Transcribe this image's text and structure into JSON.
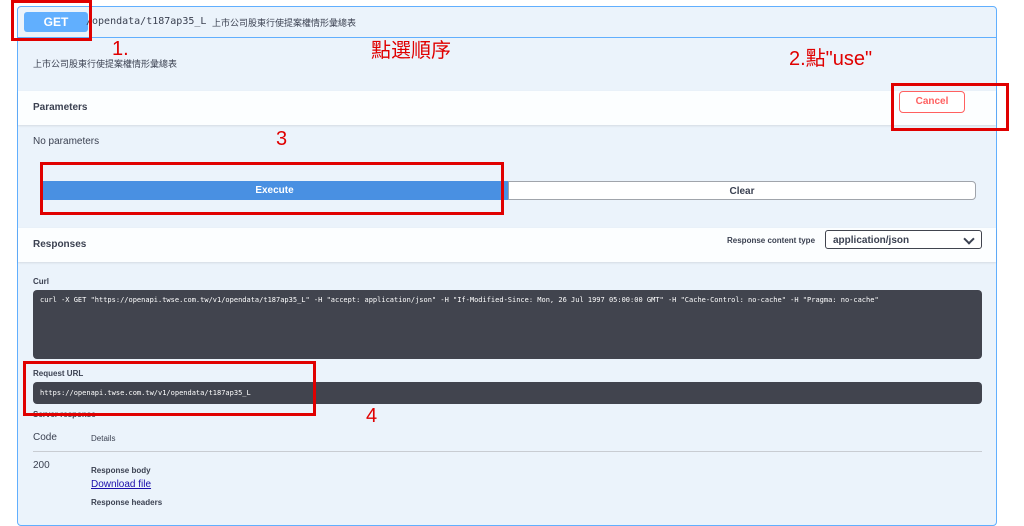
{
  "operation": {
    "method": "GET",
    "path": "/opendata/t187ap35_L",
    "summary": "上市公司股東行使提案權情形彙總表",
    "description": "上市公司股東行使提案權情形彙總表"
  },
  "parameters": {
    "title": "Parameters",
    "cancel_label": "Cancel",
    "empty_text": "No parameters"
  },
  "actions": {
    "execute_label": "Execute",
    "clear_label": "Clear"
  },
  "responses": {
    "title": "Responses",
    "content_type_label": "Response content type",
    "content_type_value": "application/json",
    "curl_label": "Curl",
    "curl_command": "curl -X GET \"https://openapi.twse.com.tw/v1/opendata/t187ap35_L\" -H \"accept: application/json\" -H \"If-Modified-Since: Mon, 26 Jul 1997 05:00:00 GMT\" -H \"Cache-Control: no-cache\" -H \"Pragma: no-cache\"",
    "request_url_label": "Request URL",
    "request_url": "https://openapi.twse.com.tw/v1/opendata/t187ap35_L",
    "server_response_label": "Server response",
    "table_headers": [
      "Code",
      "Details"
    ],
    "row_code": "200",
    "response_body_label": "Response body",
    "download_label": "Download file",
    "response_headers_label": "Response headers"
  },
  "annotations": {
    "title": "點選順序",
    "step1": "1.",
    "step2": "2.點\"use\"",
    "step3": "3",
    "step4": "4",
    "color": "#e00000"
  },
  "colors": {
    "get_blue": "#61affe",
    "execute_blue": "#4990e2",
    "cancel_red": "#ff6060",
    "code_bg": "#41444e"
  }
}
